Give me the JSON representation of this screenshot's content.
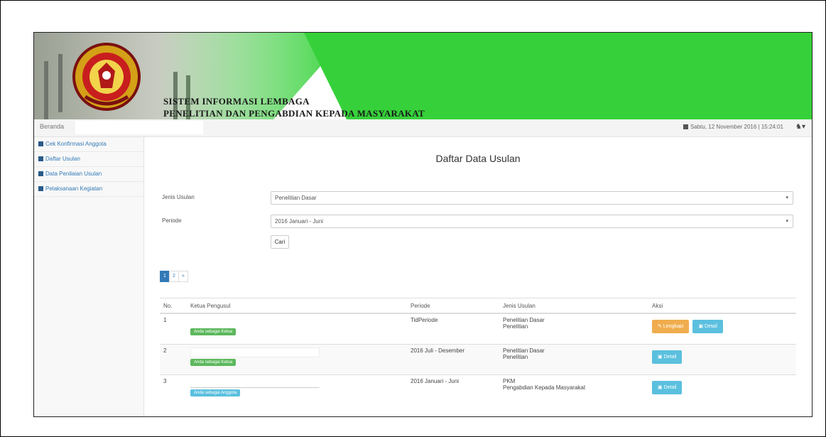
{
  "header": {
    "title_line1": "SISTEM INFORMASI LEMBAGA",
    "title_line2": "PENELITIAN DAN PENGABDIAN KEPADA MASYARAKAT"
  },
  "navbar": {
    "brand": "Beranda",
    "datetime": "Sabtu, 12 November 2016 | 15:24:01"
  },
  "sidebar": {
    "items": [
      {
        "label": "Cek Konfirmasi Anggota",
        "icon": "home-icon"
      },
      {
        "label": "Daftar Usulan",
        "icon": "list-icon"
      },
      {
        "label": "Data Penilaian Usulan",
        "icon": "list-icon"
      },
      {
        "label": "Pelaksanaan Kegiatan",
        "icon": "tasks-icon"
      }
    ]
  },
  "main": {
    "title": "Daftar Data Usulan",
    "form": {
      "jenis_label": "Jenis Usulan",
      "jenis_value": "Penelitian Dasar",
      "periode_label": "Periode",
      "periode_value": "2016 Januari - Juni",
      "cari_label": "Cari"
    },
    "pager": [
      "1",
      "2",
      "»"
    ],
    "table": {
      "headers": [
        "No.",
        "Ketua Pengusul",
        "Periode",
        "Jenis Usulan",
        "Aksi"
      ],
      "rows": [
        {
          "no": "1",
          "status": "Anda sebagai Ketua",
          "periode": "TidPeriode",
          "jenis1": "Penelitian Dasar",
          "jenis2": "Penelitian",
          "btn1": "Lengkapi",
          "btn2": "Detail"
        },
        {
          "no": "2",
          "status": "Anda sebagai Ketua",
          "periode": "2016 Juli - Desember",
          "jenis1": "Penelitian Dasar",
          "jenis2": "Penelitian",
          "btn2": "Detail"
        },
        {
          "no": "3",
          "status": "Anda sebagai Anggota",
          "periode": "2016 Januari - Juni",
          "jenis1": "PKM",
          "jenis2": "Pengabdian Kepada Masyarakat",
          "btn2": "Detail"
        }
      ]
    }
  }
}
